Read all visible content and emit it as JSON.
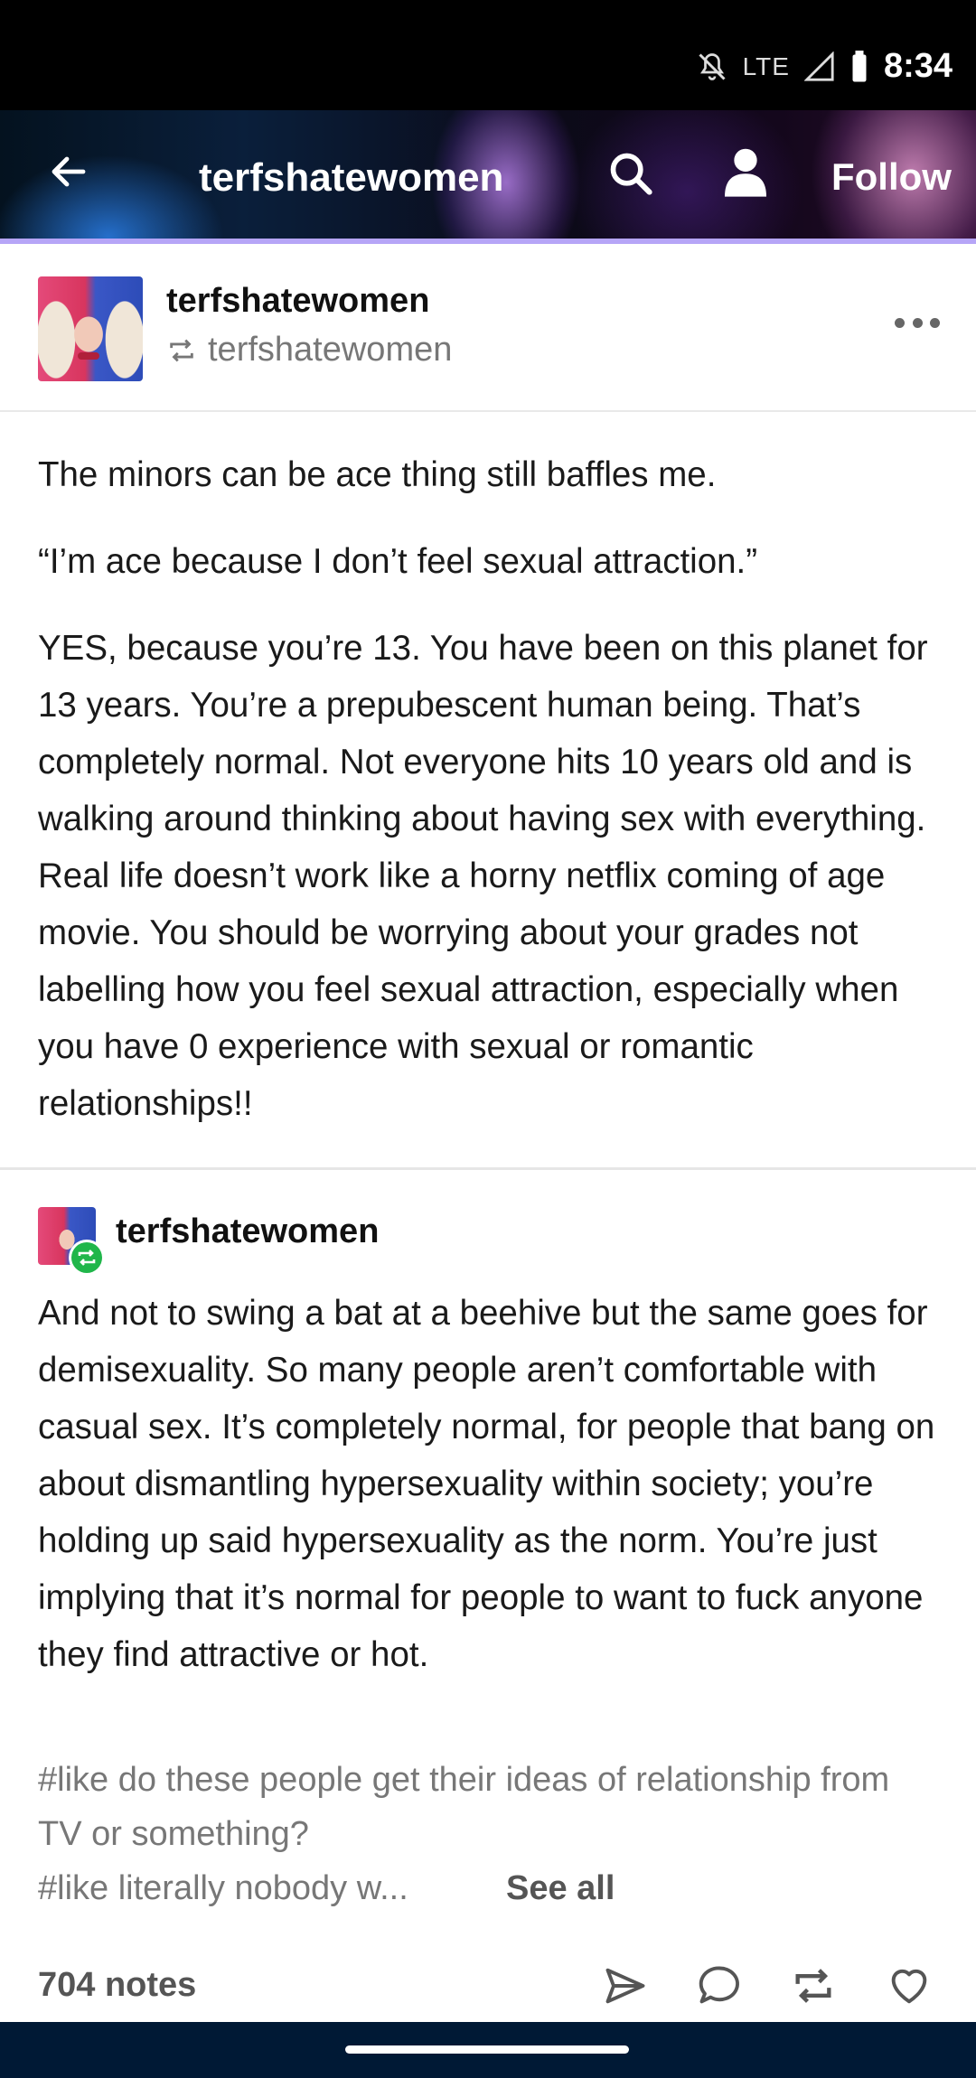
{
  "status_bar": {
    "network": "LTE",
    "time": "8:34"
  },
  "header": {
    "title": "terfshatewomen",
    "follow_label": "Follow"
  },
  "post": {
    "blog_name": "terfshatewomen",
    "reblogged_from": "terfshatewomen",
    "paragraphs": [
      "The minors can be ace thing still baffles me.",
      "“I’m ace because I don’t feel sexual attraction.”",
      "YES, because you’re 13. You have been on this planet for 13 years. You’re a prepubescent  human being. That’s completely normal. Not everyone hits 10 years old and is walking around thinking about having sex with everything. Real life doesn’t work like a horny netflix coming of age movie. You should be worrying about your grades not labelling how you feel sexual attraction, especially when you have 0 experience with sexual or romantic relationships!!"
    ],
    "reblog": {
      "blog_name": "terfshatewomen",
      "text": "And not to swing a bat at a beehive but the same goes for demisexuality. So many people aren’t comfortable with casual sex. It’s completely normal, for people that bang on about dismantling hypersexuality within society; you’re holding up said hypersexuality as the norm. You’re just implying that it’s normal for people to want to fuck anyone they find attractive or hot."
    },
    "tags": [
      "#like do these people get their ideas of relationship from TV or something?",
      "#like literally nobody w..."
    ],
    "see_all_label": "See all",
    "notes": "704 notes"
  },
  "colors": {
    "header_border": "#b6a5f7",
    "reblog_badge": "#20b64a",
    "nav_bar": "#001935"
  },
  "icons": [
    "back-arrow-icon",
    "search-icon",
    "user-icon",
    "reblog-icon",
    "more-icon",
    "share-icon",
    "comment-icon",
    "heart-icon"
  ]
}
